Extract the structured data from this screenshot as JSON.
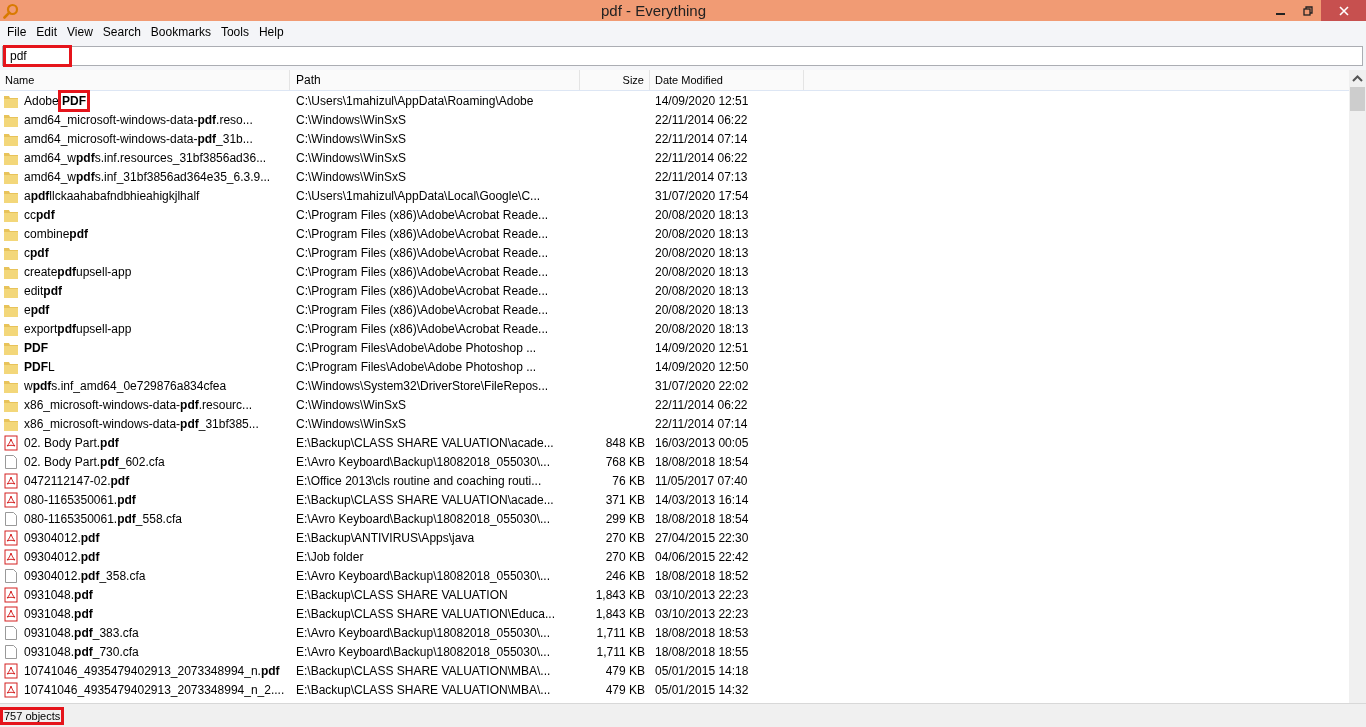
{
  "window": {
    "title": "pdf - Everything"
  },
  "menu": [
    "File",
    "Edit",
    "View",
    "Search",
    "Bookmarks",
    "Tools",
    "Help"
  ],
  "search": {
    "value": "pdf",
    "highlighted": true
  },
  "table": {
    "columns": [
      "Name",
      "Path",
      "Size",
      "Date Modified"
    ],
    "rows": [
      {
        "kind": "folder",
        "name": "Adobe **PDF**",
        "path": "C:\\Users\\1mahizul\\AppData\\Roaming\\Adobe",
        "date": "14/09/2020 12:51",
        "highlighted": true
      },
      {
        "kind": "folder",
        "name": "amd64_microsoft-windows-data-**pdf**.reso...",
        "path": "C:\\Windows\\WinSxS",
        "date": "22/11/2014 06:22",
        "highlighted": false
      },
      {
        "kind": "folder",
        "name": "amd64_microsoft-windows-data-**pdf**_31b...",
        "path": "C:\\Windows\\WinSxS",
        "date": "22/11/2014 07:14",
        "highlighted": false
      },
      {
        "kind": "folder",
        "name": "amd64_w**pdf**s.inf.resources_31bf3856ad36...",
        "path": "C:\\Windows\\WinSxS",
        "date": "22/11/2014 06:22",
        "highlighted": false
      },
      {
        "kind": "folder",
        "name": "amd64_w**pdf**s.inf_31bf3856ad364e35_6.3.9...",
        "path": "C:\\Windows\\WinSxS",
        "date": "22/11/2014 07:13",
        "highlighted": false
      },
      {
        "kind": "folder",
        "name": "a**pdf**llckaahabafndbhieahigkjlhalf",
        "path": "C:\\Users\\1mahizul\\AppData\\Local\\Google\\C...",
        "date": "31/07/2020 17:54",
        "highlighted": false
      },
      {
        "kind": "folder",
        "name": "cc**pdf**",
        "path": "C:\\Program Files (x86)\\Adobe\\Acrobat Reade...",
        "date": "20/08/2020 18:13",
        "highlighted": false
      },
      {
        "kind": "folder",
        "name": "combine**pdf**",
        "path": "C:\\Program Files (x86)\\Adobe\\Acrobat Reade...",
        "date": "20/08/2020 18:13",
        "highlighted": false
      },
      {
        "kind": "folder",
        "name": "c**pdf**",
        "path": "C:\\Program Files (x86)\\Adobe\\Acrobat Reade...",
        "date": "20/08/2020 18:13",
        "highlighted": false
      },
      {
        "kind": "folder",
        "name": "create**pdf**upsell-app",
        "path": "C:\\Program Files (x86)\\Adobe\\Acrobat Reade...",
        "date": "20/08/2020 18:13",
        "highlighted": false
      },
      {
        "kind": "folder",
        "name": "edit**pdf**",
        "path": "C:\\Program Files (x86)\\Adobe\\Acrobat Reade...",
        "date": "20/08/2020 18:13",
        "highlighted": false
      },
      {
        "kind": "folder",
        "name": "e**pdf**",
        "path": "C:\\Program Files (x86)\\Adobe\\Acrobat Reade...",
        "date": "20/08/2020 18:13",
        "highlighted": false
      },
      {
        "kind": "folder",
        "name": "export**pdf**upsell-app",
        "path": "C:\\Program Files (x86)\\Adobe\\Acrobat Reade...",
        "date": "20/08/2020 18:13",
        "highlighted": false
      },
      {
        "kind": "folder",
        "name": "**PDF**",
        "path": "C:\\Program Files\\Adobe\\Adobe Photoshop ...",
        "date": "14/09/2020 12:51",
        "highlighted": false
      },
      {
        "kind": "folder",
        "name": "**PDF**L",
        "path": "C:\\Program Files\\Adobe\\Adobe Photoshop ...",
        "date": "14/09/2020 12:50",
        "highlighted": false
      },
      {
        "kind": "folder",
        "name": "w**pdf**s.inf_amd64_0e729876a834cfea",
        "path": "C:\\Windows\\System32\\DriverStore\\FileRepos...",
        "date": "31/07/2020 22:02",
        "highlighted": false
      },
      {
        "kind": "folder",
        "name": "x86_microsoft-windows-data-**pdf**.resourc...",
        "path": "C:\\Windows\\WinSxS",
        "date": "22/11/2014 06:22",
        "highlighted": false
      },
      {
        "kind": "folder",
        "name": "x86_microsoft-windows-data-**pdf**_31bf385...",
        "path": "C:\\Windows\\WinSxS",
        "date": "22/11/2014 07:14",
        "highlighted": false
      },
      {
        "kind": "pdf",
        "name": "02. Body Part.**pdf**",
        "path": "E:\\Backup\\CLASS SHARE VALUATION\\acade...",
        "size": "848 KB",
        "date": "16/03/2013 00:05",
        "highlighted": false
      },
      {
        "kind": "file",
        "name": "02. Body Part.**pdf**_602.cfa",
        "path": "E:\\Avro Keyboard\\Backup\\18082018_055030\\...",
        "size": "768 KB",
        "date": "18/08/2018 18:54",
        "highlighted": false
      },
      {
        "kind": "pdf",
        "name": "0472112147-02.**pdf**",
        "path": "E:\\Office 2013\\cls routine and coaching routi...",
        "size": "76 KB",
        "date": "11/05/2017 07:40",
        "highlighted": false
      },
      {
        "kind": "pdf",
        "name": "080-1165350061.**pdf**",
        "path": "E:\\Backup\\CLASS SHARE VALUATION\\acade...",
        "size": "371 KB",
        "date": "14/03/2013 16:14",
        "highlighted": false
      },
      {
        "kind": "file",
        "name": "080-1165350061.**pdf**_558.cfa",
        "path": "E:\\Avro Keyboard\\Backup\\18082018_055030\\...",
        "size": "299 KB",
        "date": "18/08/2018 18:54",
        "highlighted": false
      },
      {
        "kind": "pdf",
        "name": "09304012.**pdf**",
        "path": "E:\\Backup\\ANTIVIRUS\\Apps\\java",
        "size": "270 KB",
        "date": "27/04/2015 22:30",
        "highlighted": false
      },
      {
        "kind": "pdf",
        "name": "09304012.**pdf**",
        "path": "E:\\Job folder",
        "size": "270 KB",
        "date": "04/06/2015 22:42",
        "highlighted": false
      },
      {
        "kind": "file",
        "name": "09304012.**pdf**_358.cfa",
        "path": "E:\\Avro Keyboard\\Backup\\18082018_055030\\...",
        "size": "246 KB",
        "date": "18/08/2018 18:52",
        "highlighted": false
      },
      {
        "kind": "pdf",
        "name": "0931048.**pdf**",
        "path": "E:\\Backup\\CLASS SHARE VALUATION",
        "size": "1,843 KB",
        "date": "03/10/2013 22:23",
        "highlighted": false
      },
      {
        "kind": "pdf",
        "name": "0931048.**pdf**",
        "path": "E:\\Backup\\CLASS SHARE VALUATION\\Educa...",
        "size": "1,843 KB",
        "date": "03/10/2013 22:23",
        "highlighted": false
      },
      {
        "kind": "file",
        "name": "0931048.**pdf**_383.cfa",
        "path": "E:\\Avro Keyboard\\Backup\\18082018_055030\\...",
        "size": "1,711 KB",
        "date": "18/08/2018 18:53",
        "highlighted": false
      },
      {
        "kind": "file",
        "name": "0931048.**pdf**_730.cfa",
        "path": "E:\\Avro Keyboard\\Backup\\18082018_055030\\...",
        "size": "1,711 KB",
        "date": "18/08/2018 18:55",
        "highlighted": false
      },
      {
        "kind": "pdf",
        "name": "10741046_4935479402913_2073348994_n.**pdf**",
        "path": "E:\\Backup\\CLASS SHARE VALUATION\\MBA\\...",
        "size": "479 KB",
        "date": "05/01/2015 14:18",
        "highlighted": false
      },
      {
        "kind": "pdf",
        "name": "10741046_4935479402913_2073348994_n_2....",
        "path": "E:\\Backup\\CLASS SHARE VALUATION\\MBA\\...",
        "size": "479 KB",
        "date": "05/01/2015 14:32",
        "highlighted": false
      }
    ]
  },
  "status_bar": {
    "text": "757 objects",
    "highlighted": true
  }
}
